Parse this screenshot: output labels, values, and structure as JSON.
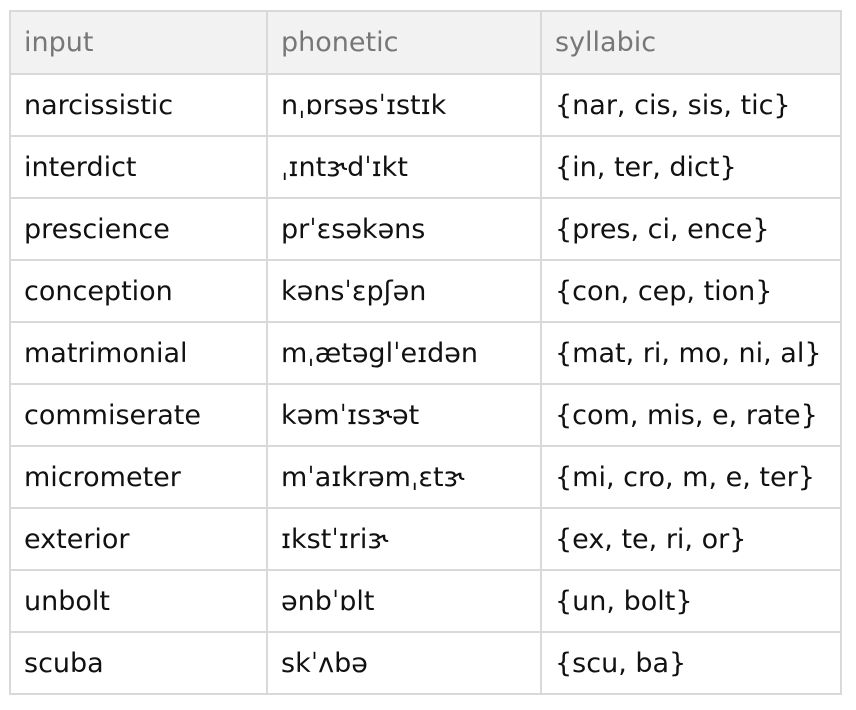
{
  "table": {
    "headers": [
      "input",
      "phonetic",
      "syllabic"
    ],
    "rows": [
      {
        "input": "narcissistic",
        "phonetic": "nˌɒrsəsˈɪstɪk",
        "syllabic": "{nar, cis, sis, tic}"
      },
      {
        "input": "interdict",
        "phonetic": "ˌɪntɝdˈɪkt",
        "syllabic": "{in, ter, dict}"
      },
      {
        "input": "prescience",
        "phonetic": "prˈɛsəkəns",
        "syllabic": "{pres, ci, ence}"
      },
      {
        "input": "conception",
        "phonetic": "kənsˈɛpʃən",
        "syllabic": "{con, cep, tion}"
      },
      {
        "input": "matrimonial",
        "phonetic": "mˌætəglˈeɪdən",
        "syllabic": "{mat, ri, mo, ni, al}"
      },
      {
        "input": "commiserate",
        "phonetic": "kəmˈɪsɝət",
        "syllabic": "{com, mis, e, rate}"
      },
      {
        "input": "micrometer",
        "phonetic": "mˈaɪkrəmˌɛtɝ",
        "syllabic": "{mi, cro, m, e, ter}"
      },
      {
        "input": "exterior",
        "phonetic": "ɪkstˈɪriɝ",
        "syllabic": "{ex, te, ri, or}"
      },
      {
        "input": "unbolt",
        "phonetic": "ənbˈɒlt",
        "syllabic": "{un, bolt}"
      },
      {
        "input": "scuba",
        "phonetic": "skˈʌbə",
        "syllabic": "{scu, ba}"
      }
    ]
  }
}
